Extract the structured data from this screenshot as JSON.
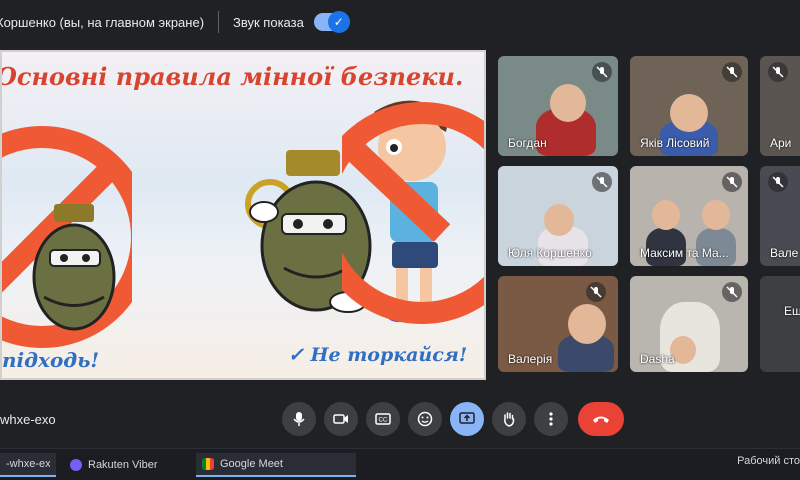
{
  "topbar": {
    "presenter": "Коршенко (вы, на главном экране)",
    "sound_label": "Звук показа",
    "sound_on": true
  },
  "slide": {
    "title": "Основні правила мінної безпеки.",
    "caption_left": "підходь!",
    "caption_right": "✓ Не торкайся!",
    "colors": {
      "title": "#d8452e",
      "caption": "#2f70c2",
      "ban": "#ef5a35"
    }
  },
  "participants": [
    {
      "name": "Богдан",
      "muted": true
    },
    {
      "name": "Яків Лісовий",
      "muted": true
    },
    {
      "name": "Ари",
      "muted": true
    },
    {
      "name": "Юля Коршенко",
      "muted": true
    },
    {
      "name": "Максим та Ма...",
      "muted": true
    },
    {
      "name": "Вале",
      "muted": true
    },
    {
      "name": "Валерія",
      "muted": true
    },
    {
      "name": "Dasha",
      "muted": true
    },
    {
      "name": "Еш",
      "muted": true
    }
  ],
  "meeting": {
    "code": "whxe-exo"
  },
  "controls": {
    "icons": [
      "mic-icon",
      "camera-icon",
      "captions-icon",
      "emoji-icon",
      "present-icon",
      "raise-hand-icon",
      "more-icon",
      "end-call-icon"
    ]
  },
  "taskbar": {
    "items": [
      {
        "label": "-whxe-exo ...",
        "icon": "meet-tab-icon"
      },
      {
        "label": "Rakuten Viber",
        "icon": "viber-icon"
      },
      {
        "label": "Google Meet",
        "icon": "google-meet-icon"
      }
    ],
    "tray": "Рабочий сто"
  }
}
